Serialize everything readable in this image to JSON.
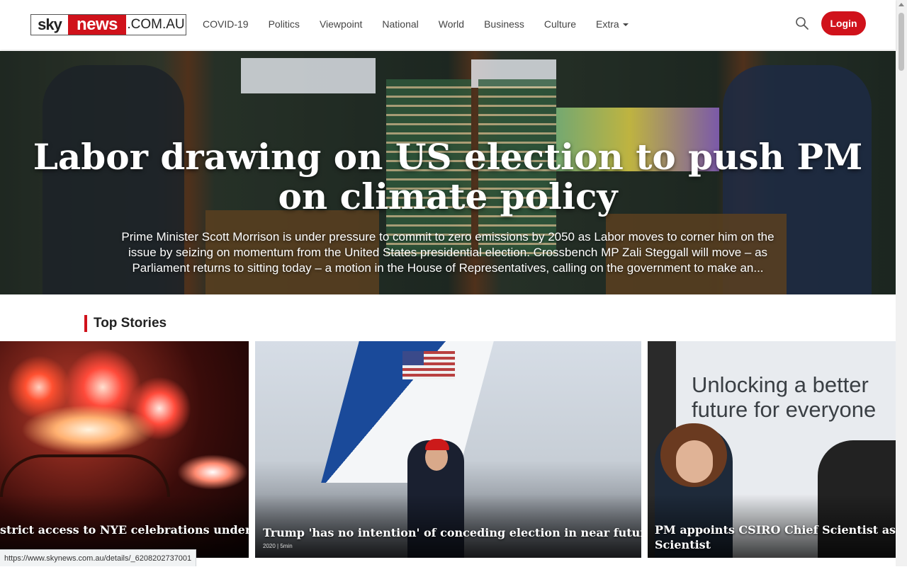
{
  "header": {
    "logo": {
      "sky": "sky",
      "news": "news",
      "domain": ".COM.AU"
    },
    "nav": [
      {
        "label": "COVID-19"
      },
      {
        "label": "Politics"
      },
      {
        "label": "Viewpoint"
      },
      {
        "label": "National"
      },
      {
        "label": "World"
      },
      {
        "label": "Business"
      },
      {
        "label": "Culture"
      },
      {
        "label": "Extra"
      }
    ],
    "login_label": "Login"
  },
  "hero": {
    "title": "Labor drawing on US election to push PM on climate policy",
    "summary": "Prime Minister Scott Morrison is under pressure to commit to zero emissions by 2050 as Labor moves to corner him on the issue by seizing on momentum from the United States presidential election. Crossbench MP Zali Steggall will move – as Parliament returns to sitting today – a motion in the House of Representatives, calling on the government to make an..."
  },
  "top_stories": {
    "title": "Top Stories",
    "cards": [
      {
        "headline": "strict access to NYE celebrations under",
        "meta": ""
      },
      {
        "headline": "Trump 'has no intention' of conceding election in near future",
        "meta": "2020 | 5min"
      },
      {
        "headline": "PM appoints CSIRO Chief Scientist as Aust",
        "headline_line2": "Scientist",
        "banner_line1": "Unlocking a better",
        "banner_line2": "future for everyone"
      }
    ]
  },
  "status_bar": {
    "url": "https://www.skynews.com.au/details/_6208202737001"
  },
  "colors": {
    "brand_red": "#d0121b",
    "nav_text": "#444444"
  },
  "icons": {
    "search": "search-icon",
    "dropdown": "chevron-down-icon"
  }
}
